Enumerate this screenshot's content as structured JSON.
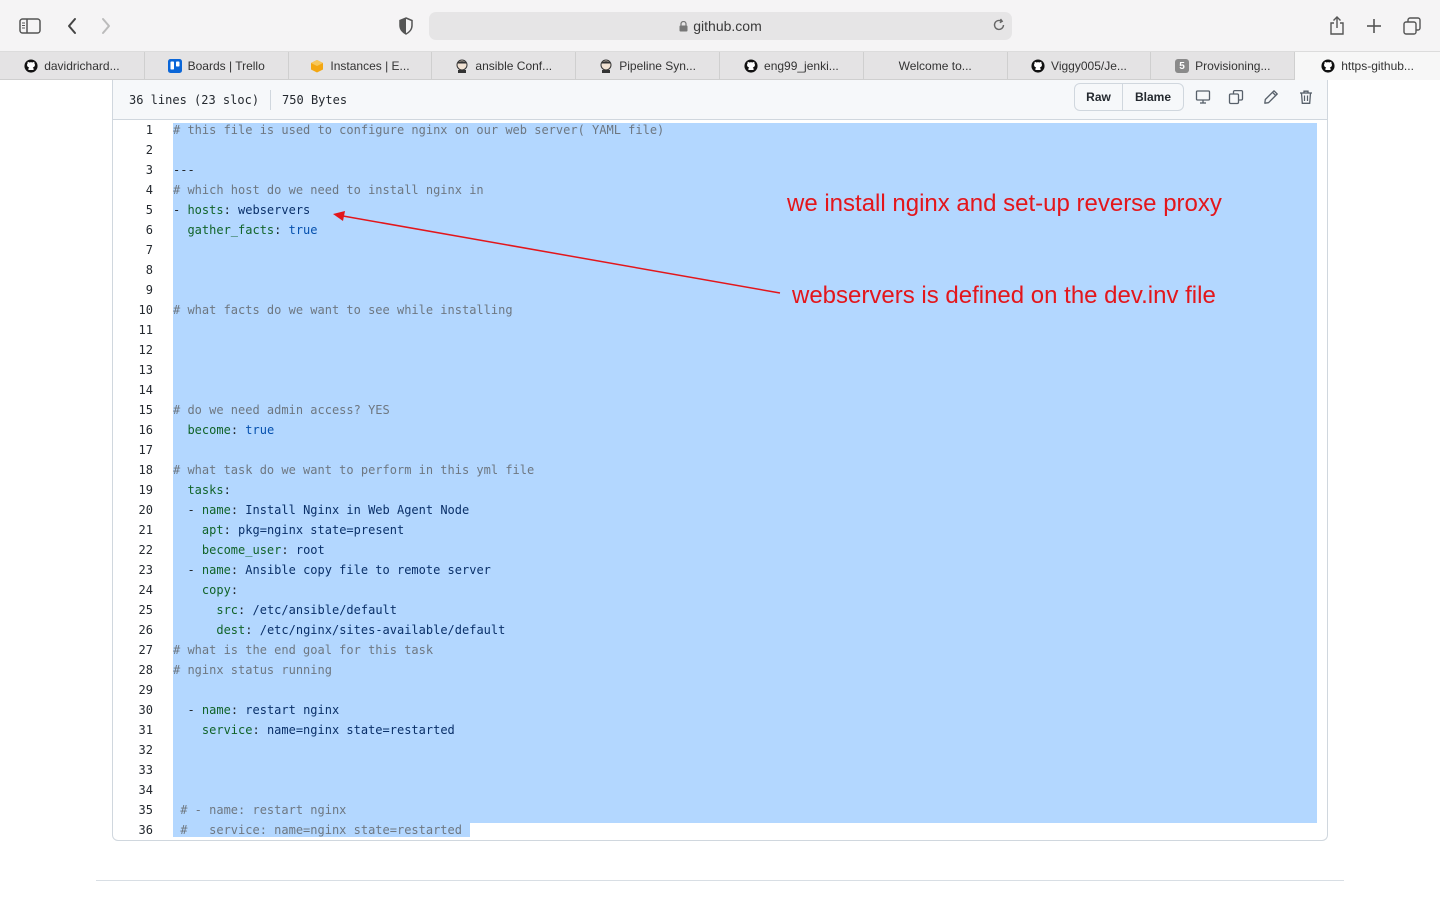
{
  "browser": {
    "url": "github.com",
    "tabs": [
      {
        "label": "davidrichard...",
        "icon": "github-icon"
      },
      {
        "label": "Boards | Trello",
        "icon": "trello-icon"
      },
      {
        "label": "Instances | E...",
        "icon": "aws-icon"
      },
      {
        "label": "ansible Conf...",
        "icon": "jenkins-icon"
      },
      {
        "label": "Pipeline Syn...",
        "icon": "jenkins-icon"
      },
      {
        "label": "eng99_jenki...",
        "icon": "github-icon"
      },
      {
        "label": "Welcome to...",
        "icon": ""
      },
      {
        "label": "Viggy005/Je...",
        "icon": "github-icon"
      },
      {
        "label": "Provisioning...",
        "icon": "badge-5-icon",
        "badge": "5"
      },
      {
        "label": "https-github...",
        "icon": "github-icon"
      }
    ]
  },
  "file": {
    "lines_info": "36 lines (23 sloc)",
    "size": "750 Bytes",
    "raw_label": "Raw",
    "blame_label": "Blame"
  },
  "code_lines": [
    {
      "n": "1",
      "parts": [
        [
          "com",
          "# this file is used to configure nginx on our web server( YAML file)"
        ]
      ]
    },
    {
      "n": "2",
      "parts": []
    },
    {
      "n": "3",
      "parts": [
        [
          "plain",
          "---"
        ]
      ]
    },
    {
      "n": "4",
      "parts": [
        [
          "com",
          "# which host do we need to install nginx in"
        ]
      ]
    },
    {
      "n": "5",
      "parts": [
        [
          "plain",
          "- "
        ],
        [
          "key",
          "hosts"
        ],
        [
          "plain",
          ": "
        ],
        [
          "val",
          "webservers"
        ]
      ]
    },
    {
      "n": "6",
      "parts": [
        [
          "plain",
          "  "
        ],
        [
          "key",
          "gather_facts"
        ],
        [
          "plain",
          ": "
        ],
        [
          "bool",
          "true"
        ]
      ]
    },
    {
      "n": "7",
      "parts": []
    },
    {
      "n": "8",
      "parts": []
    },
    {
      "n": "9",
      "parts": []
    },
    {
      "n": "10",
      "parts": [
        [
          "com",
          "# what facts do we want to see while installing"
        ]
      ]
    },
    {
      "n": "11",
      "parts": []
    },
    {
      "n": "12",
      "parts": []
    },
    {
      "n": "13",
      "parts": []
    },
    {
      "n": "14",
      "parts": []
    },
    {
      "n": "15",
      "parts": [
        [
          "com",
          "# do we need admin access? YES"
        ]
      ]
    },
    {
      "n": "16",
      "parts": [
        [
          "plain",
          "  "
        ],
        [
          "key",
          "become"
        ],
        [
          "plain",
          ": "
        ],
        [
          "bool",
          "true"
        ]
      ]
    },
    {
      "n": "17",
      "parts": []
    },
    {
      "n": "18",
      "parts": [
        [
          "com",
          "# what task do we want to perform in this yml file"
        ]
      ]
    },
    {
      "n": "19",
      "parts": [
        [
          "plain",
          "  "
        ],
        [
          "key",
          "tasks"
        ],
        [
          "plain",
          ":"
        ]
      ]
    },
    {
      "n": "20",
      "parts": [
        [
          "plain",
          "  - "
        ],
        [
          "key",
          "name"
        ],
        [
          "plain",
          ": "
        ],
        [
          "val",
          "Install Nginx in Web Agent Node"
        ]
      ]
    },
    {
      "n": "21",
      "parts": [
        [
          "plain",
          "    "
        ],
        [
          "key",
          "apt"
        ],
        [
          "plain",
          ": "
        ],
        [
          "val",
          "pkg=nginx state=present"
        ]
      ]
    },
    {
      "n": "22",
      "parts": [
        [
          "plain",
          "    "
        ],
        [
          "key",
          "become_user"
        ],
        [
          "plain",
          ": "
        ],
        [
          "val",
          "root"
        ]
      ]
    },
    {
      "n": "23",
      "parts": [
        [
          "plain",
          "  - "
        ],
        [
          "key",
          "name"
        ],
        [
          "plain",
          ": "
        ],
        [
          "val",
          "Ansible copy file to remote server"
        ]
      ]
    },
    {
      "n": "24",
      "parts": [
        [
          "plain",
          "    "
        ],
        [
          "key",
          "copy"
        ],
        [
          "plain",
          ":"
        ]
      ]
    },
    {
      "n": "25",
      "parts": [
        [
          "plain",
          "      "
        ],
        [
          "key",
          "src"
        ],
        [
          "plain",
          ": "
        ],
        [
          "val",
          "/etc/ansible/default"
        ]
      ]
    },
    {
      "n": "26",
      "parts": [
        [
          "plain",
          "      "
        ],
        [
          "key",
          "dest"
        ],
        [
          "plain",
          ": "
        ],
        [
          "val",
          "/etc/nginx/sites-available/default"
        ]
      ]
    },
    {
      "n": "27",
      "parts": [
        [
          "com",
          "# what is the end goal for this task"
        ]
      ]
    },
    {
      "n": "28",
      "parts": [
        [
          "com",
          "# nginx status running"
        ]
      ]
    },
    {
      "n": "29",
      "parts": []
    },
    {
      "n": "30",
      "parts": [
        [
          "plain",
          "  - "
        ],
        [
          "key",
          "name"
        ],
        [
          "plain",
          ": "
        ],
        [
          "val",
          "restart nginx"
        ]
      ]
    },
    {
      "n": "31",
      "parts": [
        [
          "plain",
          "    "
        ],
        [
          "key",
          "service"
        ],
        [
          "plain",
          ": "
        ],
        [
          "val",
          "name=nginx state=restarted"
        ]
      ]
    },
    {
      "n": "32",
      "parts": []
    },
    {
      "n": "33",
      "parts": []
    },
    {
      "n": "34",
      "parts": []
    },
    {
      "n": "35",
      "parts": [
        [
          "com",
          " # - name: restart nginx"
        ]
      ]
    },
    {
      "n": "36",
      "parts": [
        [
          "com",
          " #   service: name=nginx state=restarted"
        ]
      ]
    }
  ],
  "annotations": {
    "top": "we install nginx and set-up reverse proxy",
    "bottom": "webservers is defined on the dev.inv file",
    "color": "#e3161b"
  }
}
